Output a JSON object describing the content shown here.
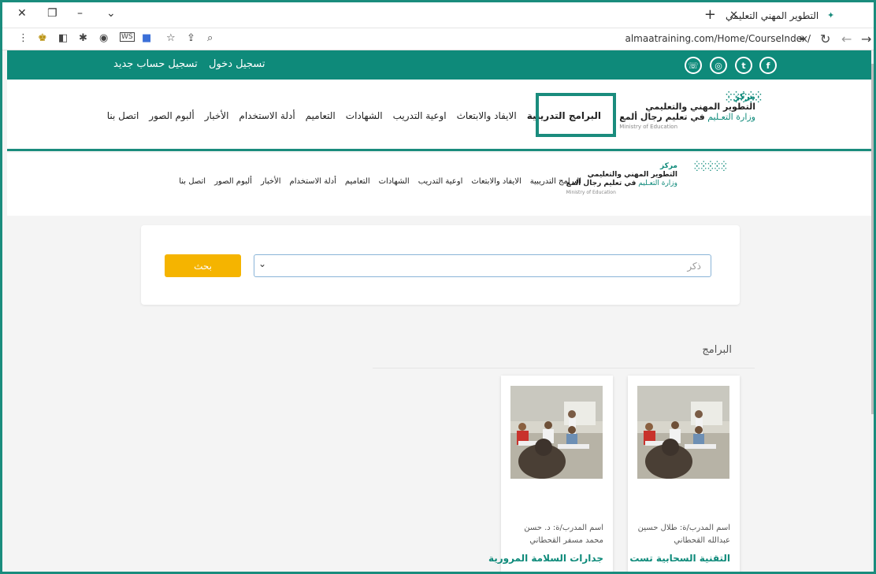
{
  "browser": {
    "tab_title": "التطوير المهني التعليمي",
    "url": "almaatraining.com/Home/CourseIndex/"
  },
  "topbar": {
    "login": "تسجيل دخول",
    "register": "تسجيل حساب جديد",
    "social": [
      "facebook-icon",
      "twitter-icon",
      "instagram-icon",
      "whatsapp-icon"
    ]
  },
  "logo": {
    "line1": "مركز",
    "line2": "التطوير المهني والتعليمي",
    "line3a": "وزارة التعـليم",
    "line3b": "في تعليم رجال ألمع",
    "line4": "Ministry of Education"
  },
  "nav": {
    "items": [
      "البرامج التدريبية",
      "الايفاد والابتعاث",
      "اوعية التدريب",
      "الشهادات",
      "التعاميم",
      "أدلة الاستخدام",
      "الأخبار",
      "ألبوم الصور",
      "اتصل بنا"
    ]
  },
  "search": {
    "select_value": "ذكر",
    "button_label": "بحث"
  },
  "section": {
    "title": "البرامج"
  },
  "courses": [
    {
      "trainer": "اسم المدرب/ة: طلال حسين عبدالله القحطاني",
      "title": "التقنية السحابية تست"
    },
    {
      "trainer": "اسم المدرب/ة: د. حسن محمد مسفر القحطاني",
      "title": "جدارات السلامة المرورية"
    }
  ],
  "colors": {
    "brand": "#0e8a7a",
    "accent": "#f5b400",
    "highlight": "#1a8c7d"
  }
}
